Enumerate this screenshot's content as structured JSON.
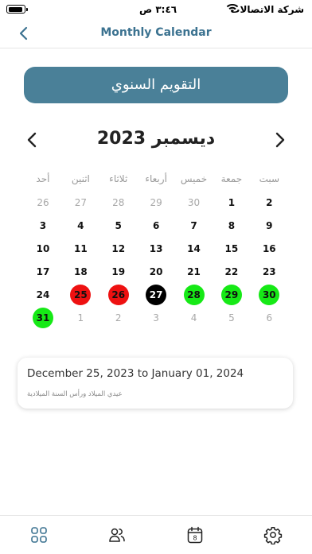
{
  "status_bar": {
    "carrier": "شركة الاتصالات",
    "time": "٣:٤٦ ص"
  },
  "nav": {
    "title": "Monthly Calendar",
    "back_icon": "chevron-left-icon"
  },
  "yearly_button_label": "التقويم السنوي",
  "month": {
    "title": "ديسمبر 2023",
    "prev_icon": "chevron-left-icon",
    "next_icon": "chevron-right-icon"
  },
  "weekdays": [
    "سبت",
    "جمعة",
    "خميس",
    "أربعاء",
    "ثلاثاء",
    "اثنين",
    "أحد"
  ],
  "days": [
    {
      "n": "2",
      "state": "normal"
    },
    {
      "n": "1",
      "state": "normal"
    },
    {
      "n": "30",
      "state": "muted"
    },
    {
      "n": "29",
      "state": "muted"
    },
    {
      "n": "28",
      "state": "muted"
    },
    {
      "n": "27",
      "state": "muted"
    },
    {
      "n": "26",
      "state": "muted"
    },
    {
      "n": "9",
      "state": "normal"
    },
    {
      "n": "8",
      "state": "normal"
    },
    {
      "n": "7",
      "state": "normal"
    },
    {
      "n": "6",
      "state": "normal"
    },
    {
      "n": "5",
      "state": "normal"
    },
    {
      "n": "4",
      "state": "normal"
    },
    {
      "n": "3",
      "state": "normal"
    },
    {
      "n": "16",
      "state": "normal"
    },
    {
      "n": "15",
      "state": "normal"
    },
    {
      "n": "14",
      "state": "normal"
    },
    {
      "n": "13",
      "state": "normal"
    },
    {
      "n": "12",
      "state": "normal"
    },
    {
      "n": "11",
      "state": "normal"
    },
    {
      "n": "10",
      "state": "normal"
    },
    {
      "n": "23",
      "state": "normal"
    },
    {
      "n": "22",
      "state": "normal"
    },
    {
      "n": "21",
      "state": "normal"
    },
    {
      "n": "20",
      "state": "normal"
    },
    {
      "n": "19",
      "state": "normal"
    },
    {
      "n": "18",
      "state": "normal"
    },
    {
      "n": "17",
      "state": "normal"
    },
    {
      "n": "30",
      "state": "green"
    },
    {
      "n": "29",
      "state": "green"
    },
    {
      "n": "28",
      "state": "green"
    },
    {
      "n": "27",
      "state": "black"
    },
    {
      "n": "26",
      "state": "red"
    },
    {
      "n": "25",
      "state": "red"
    },
    {
      "n": "24",
      "state": "normal"
    },
    {
      "n": "6",
      "state": "muted"
    },
    {
      "n": "5",
      "state": "muted"
    },
    {
      "n": "4",
      "state": "muted"
    },
    {
      "n": "3",
      "state": "muted"
    },
    {
      "n": "2",
      "state": "muted"
    },
    {
      "n": "1",
      "state": "muted"
    },
    {
      "n": "31",
      "state": "green"
    }
  ],
  "colors": {
    "accent": "#4a8098",
    "title": "#3b7290",
    "holiday_red": "#ee1111",
    "today_black": "#000000",
    "holiday_green": "#16e916"
  },
  "event": {
    "dates": "December 25, 2023 to January 01, 2024",
    "description": "عيدي الميلاد ورأس السنة الميلادية"
  },
  "tabs": [
    {
      "name": "tab-home",
      "icon": "grid-icon"
    },
    {
      "name": "tab-users",
      "icon": "users-icon"
    },
    {
      "name": "tab-calendar",
      "icon": "calendar-icon",
      "badge": "8"
    },
    {
      "name": "tab-settings",
      "icon": "gear-icon"
    }
  ]
}
